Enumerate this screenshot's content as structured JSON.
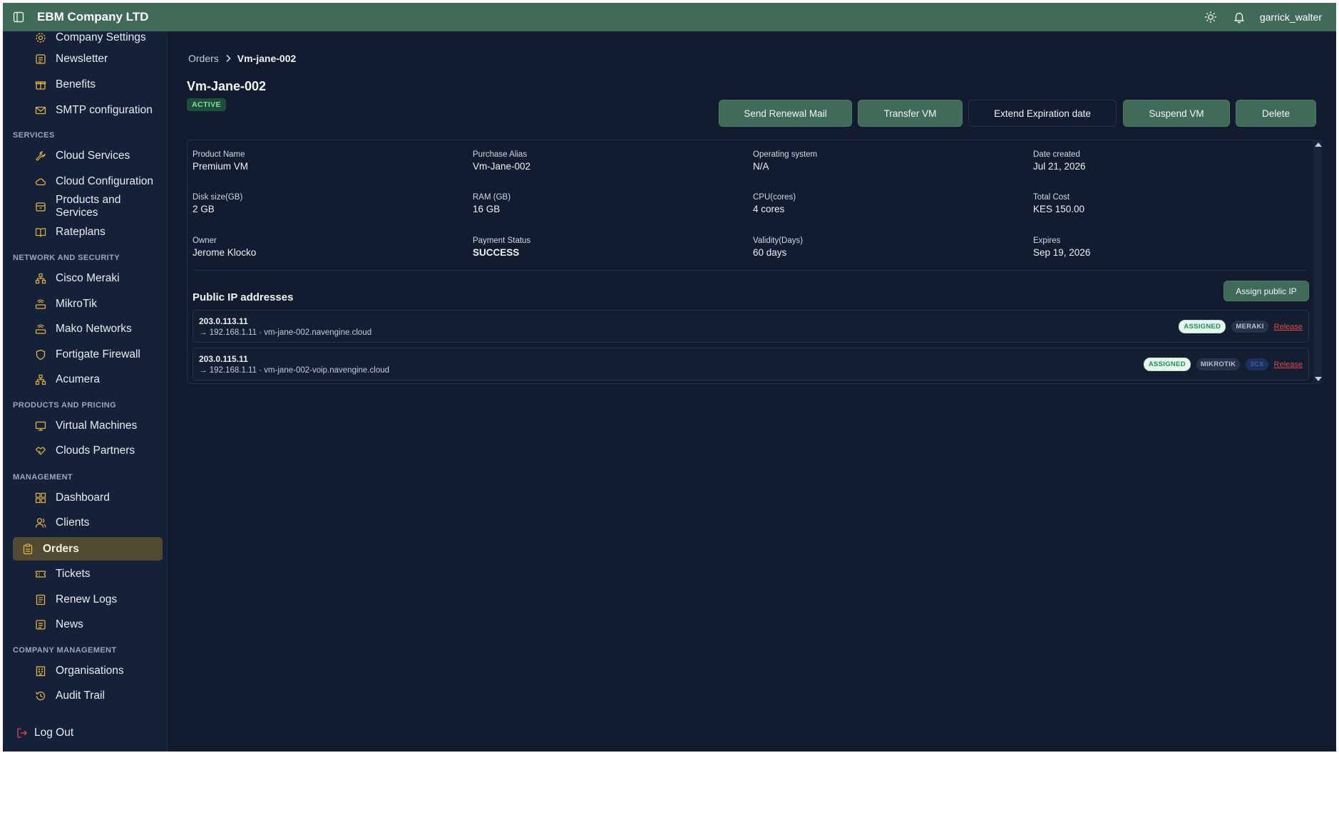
{
  "topbar": {
    "brand": "EBM Company LTD",
    "username": "garrick_walter"
  },
  "sidebar": {
    "items_top": [
      {
        "label": "Company Settings",
        "icon": "gear-icon"
      },
      {
        "label": "Newsletter",
        "icon": "newsletter-icon"
      },
      {
        "label": "Benefits",
        "icon": "gift-icon"
      },
      {
        "label": "SMTP configuration",
        "icon": "mail-icon"
      }
    ],
    "sections": [
      {
        "title": "SERVICES",
        "items": [
          {
            "label": "Cloud Services",
            "icon": "wrench-icon"
          },
          {
            "label": "Cloud Configuration",
            "icon": "cloud-icon"
          },
          {
            "label": "Products and Services",
            "icon": "package-icon"
          },
          {
            "label": "Rateplans",
            "icon": "book-icon"
          }
        ]
      },
      {
        "title": "NETWORK AND SECURITY",
        "items": [
          {
            "label": "Cisco Meraki",
            "icon": "network-icon"
          },
          {
            "label": "MikroTik",
            "icon": "router-icon"
          },
          {
            "label": "Mako Networks",
            "icon": "router-icon"
          },
          {
            "label": "Fortigate Firewall",
            "icon": "shield-icon"
          },
          {
            "label": "Acumera",
            "icon": "network-icon"
          }
        ]
      },
      {
        "title": "PRODUCTS AND PRICING",
        "items": [
          {
            "label": "Virtual Machines",
            "icon": "monitor-icon"
          },
          {
            "label": "Clouds Partners",
            "icon": "handshake-icon"
          }
        ]
      },
      {
        "title": "MANAGEMENT",
        "items": [
          {
            "label": "Dashboard",
            "icon": "dashboard-icon"
          },
          {
            "label": "Clients",
            "icon": "users-icon"
          },
          {
            "label": "Orders",
            "icon": "clipboard-icon"
          },
          {
            "label": "Tickets",
            "icon": "ticket-icon"
          },
          {
            "label": "Renew Logs",
            "icon": "log-icon"
          },
          {
            "label": "News",
            "icon": "newspaper-icon"
          }
        ]
      },
      {
        "title": "COMPANY MANAGEMENT",
        "items": [
          {
            "label": "Organisations",
            "icon": "building-icon"
          },
          {
            "label": "Audit Trail",
            "icon": "history-icon"
          }
        ]
      }
    ],
    "active": "Orders",
    "logout": "Log Out"
  },
  "breadcrumb": {
    "parent": "Orders",
    "current": "Vm-jane-002"
  },
  "order": {
    "title": "Vm-Jane-002",
    "status": "ACTIVE"
  },
  "actions": {
    "send_renewal": "Send Renewal Mail",
    "transfer": "Transfer VM",
    "extend": "Extend Expiration date",
    "suspend": "Suspend VM",
    "delete": "Delete"
  },
  "details": {
    "product_name": {
      "label": "Product Name",
      "value": "Premium VM"
    },
    "purchase_alias": {
      "label": "Purchase Alias",
      "value": "Vm-Jane-002"
    },
    "operating_system": {
      "label": "Operating system",
      "value": "N/A"
    },
    "date_created": {
      "label": "Date created",
      "value": "Jul 21, 2026"
    },
    "disk_size": {
      "label": "Disk size(GB)",
      "value": "2 GB"
    },
    "ram": {
      "label": "RAM (GB)",
      "value": "16 GB"
    },
    "cpu": {
      "label": "CPU(cores)",
      "value": "4 cores"
    },
    "total_cost": {
      "label": "Total Cost",
      "value": "KES 150.00"
    },
    "owner": {
      "label": "Owner",
      "value": "Jerome Klocko"
    },
    "payment_status": {
      "label": "Payment Status",
      "value": "SUCCESS"
    },
    "validity": {
      "label": "Validity(Days)",
      "value": "60 days"
    },
    "expires": {
      "label": "Expires",
      "value": "Sep 19, 2026"
    }
  },
  "public_ips": {
    "title": "Public IP addresses",
    "assign_label": "Assign public IP",
    "rows": [
      {
        "ip": "203.0.113.11",
        "mapping": "→ 192.168.1.11 · vm-jane-002.navengine.cloud",
        "status": "ASSIGNED",
        "vendor": "MERAKI",
        "extra": "",
        "action": "Release"
      },
      {
        "ip": "203.0.115.11",
        "mapping": "→ 192.168.1.11 · vm-jane-002-voip.navengine.cloud",
        "status": "ASSIGNED",
        "vendor": "MIKROTIK",
        "extra": "3CX",
        "action": "Release"
      }
    ]
  },
  "colors": {
    "topbar": "#3f6b58",
    "sidebar": "#152138",
    "background": "#131c2e",
    "active_item": "#4f4a30",
    "primary_button": "#3f6b58",
    "release_link": "#e0474f"
  }
}
